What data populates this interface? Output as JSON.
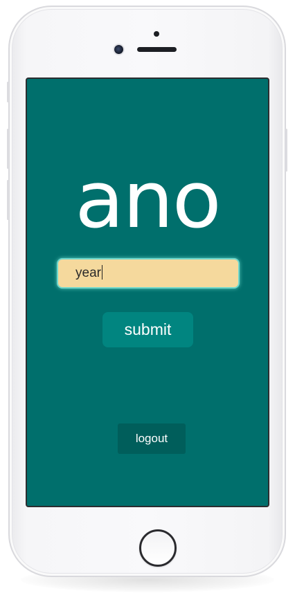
{
  "app": {
    "title": "ano"
  },
  "form": {
    "year_value": "year",
    "submit_label": "submit"
  },
  "footer": {
    "logout_label": "logout"
  },
  "colors": {
    "screen_background": "#006f6c",
    "input_background": "#f5d99d",
    "input_glow": "#6fd7cc",
    "submit_background": "#018580",
    "logout_background": "#005e5b",
    "text": "#ffffff"
  },
  "icons": {
    "home_button": "home-button-icon",
    "camera": "front-camera-icon",
    "speaker": "earpiece-speaker-icon"
  }
}
